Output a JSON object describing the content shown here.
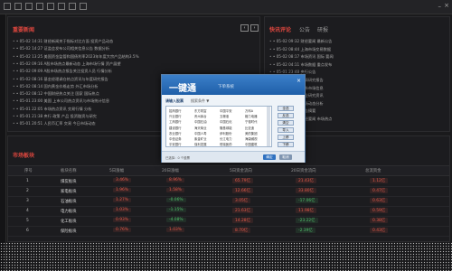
{
  "left_panel": {
    "title": "重要新闻",
    "news": [
      "• 05-02 14:31 财经新闻关于指标对比方面 投资产品动态",
      "• 05-02 14:27 证监会发布公司相关信息公告 数据分析",
      "• 05-02 13:25 美国资金监管和国债利率2023年年度大宗产品结构3.5%",
      "• 05-02 09:16 A股市场热点最新动态 上海市场行情 资产展望",
      "• 05-02 09:09 A股市场热点报告关注投资人员 行情分析",
      "• 05-02 08:16 基金经理调仓热点资讯与年度研究报告",
      "• 05-02 08:14 国内黄金价格走势 外汇市场分析",
      "• 05-02 08:12 中国财经热点关注 国家 国际热点",
      "• 05-01 23:00 美国 上市公司热点资讯与市场统计信息",
      "• 05-01 22:05 市场热点资讯 交易行情 分析",
      "• 05-01 21:38 央行 政策 产品 投资融资与研究",
      "• 05-01 20:51 人民币汇率 交易 今日市场动态"
    ]
  },
  "right_panel": {
    "tabs": [
      "快讯评论",
      "公告",
      "研报"
    ],
    "news": [
      "• 05-02 09:32 财经要闻 最新公告",
      "• 05-02 08:44 上海市场交易数据",
      "• 05-02 08:17 市场资讯 国际 要闻",
      "• 05-02 04:11 市场数据 重点发布",
      "• 05-01 23:48 央行公告",
      "• 05-01 21:16 行情研究报告",
      "• 05-01 19:47 证券市场信息",
      "• 05-01 18:30 行业研究资讯",
      "• 05-01 16:12 市场动态分析",
      "• 05-01 15:02 公告摘要",
      "• 05-01 13:47 财经要闻 市场热点"
    ]
  },
  "board": {
    "title": "市场板块",
    "headers": [
      "序号",
      "板块名称",
      "5日涨幅",
      "20日涨幅",
      "5日资金流向",
      "20日资金流向",
      "总流资金"
    ],
    "rows": [
      {
        "rank": "1",
        "name": "煤炭板块",
        "c1": "3.46%",
        "c2": "8.96%",
        "c3": "65.79亿",
        "c4": "21.43亿",
        "c5": "1.12亿"
      },
      {
        "rank": "2",
        "name": "家电板块",
        "c1": "1.96%",
        "c2": "1.58%",
        "c3": "12.66亿",
        "c4": "33.80亿",
        "c5": "0.47亿"
      },
      {
        "rank": "3",
        "name": "石油板块",
        "c1": "1.27%",
        "c2": "-0.06%",
        "c3": "3.05亿",
        "c4": "-17.06亿",
        "c5": "0.63亿"
      },
      {
        "rank": "4",
        "name": "电力板块",
        "c1": "1.03%",
        "c2": "-1.15%",
        "c3": "21.63亿",
        "c4": "11.98亿",
        "c5": "0.59亿"
      },
      {
        "rank": "5",
        "name": "化工板块",
        "c1": "0.93%",
        "c2": "-4.08%",
        "c3": "14.28亿",
        "c4": "-23.22亿",
        "c5": "0.38亿"
      },
      {
        "rank": "6",
        "name": "保险板块",
        "c1": "0.76%",
        "c2": "1.03%",
        "c3": "8.70亿",
        "c4": "-2.39亿",
        "c5": "0.43亿"
      }
    ]
  },
  "modal": {
    "title": "一键通",
    "subtitle": "下单系统",
    "filter_label": "请输入股票",
    "filter_hint": "搜索条件 ▼",
    "list": [
      [
        "招商银行",
        "东方财富",
        "中国平安",
        "万科A"
      ],
      [
        "兴业银行",
        "贵州茅台",
        "五粮液",
        "格力电器"
      ],
      [
        "工商银行",
        "中国石油",
        "中国石化",
        "宁德时代"
      ],
      [
        "建设银行",
        "海天味业",
        "隆基绿能",
        "比亚迪"
      ],
      [
        "农业银行",
        "中国人寿",
        "伊利股份",
        "美的集团"
      ],
      [
        "中信证券",
        "紫金矿业",
        "长江电力",
        "海康威视"
      ],
      [
        "平安银行",
        "保利发展",
        "恒瑞医药",
        "中国建筑"
      ]
    ],
    "buttons": [
      "全选",
      "反选",
      "清空",
      "导入",
      "上移",
      "下移"
    ],
    "footer_text": "已选择：0 个股票",
    "ok": "确定",
    "cancel": "取消"
  },
  "colors": {
    "accent_red": "#e25a4a",
    "accent_green": "#4fbf6a",
    "modal_blue": "#2f71c0"
  }
}
